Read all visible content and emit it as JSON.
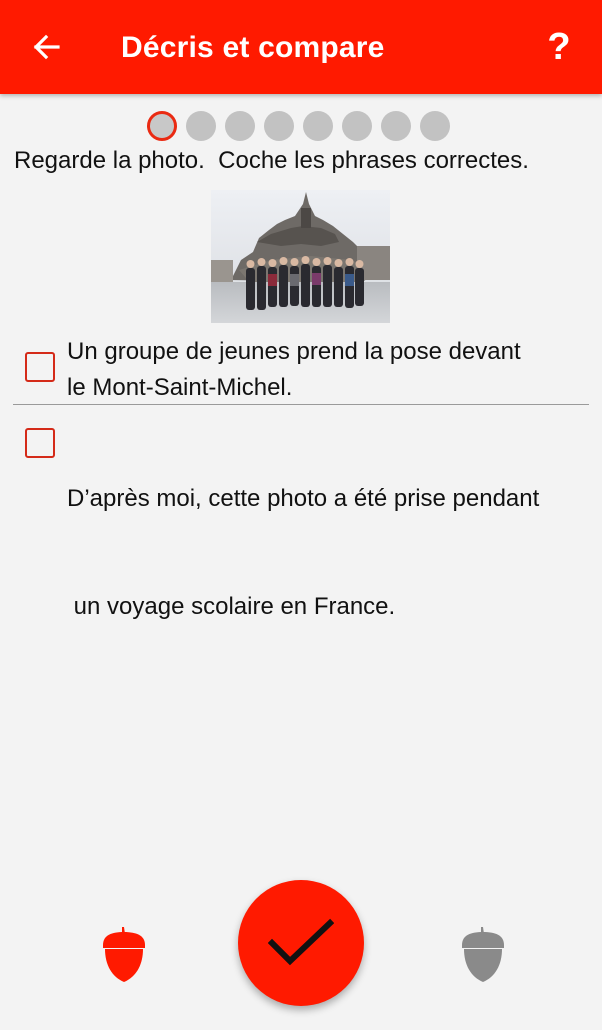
{
  "appbar": {
    "title": "Décris et compare",
    "back_icon": "arrow-left-icon",
    "help_label": "?",
    "color": "#ff1a00"
  },
  "progress": {
    "total": 8,
    "current": 1
  },
  "instruction": "Regarde la photo.  Coche les phrases correctes.",
  "photo": {
    "subject": "group-photo-mont-saint-michel"
  },
  "statements": [
    {
      "line1": "Un groupe de jeunes prend la pose devant",
      "line2": "le Mont-Saint-Michel.",
      "checked": false
    },
    {
      "line1": "D’après moi, cette photo a été prise pendant",
      "line2": " un voyage scolaire en France.",
      "checked": false
    }
  ],
  "footer": {
    "check_icon": "checkmark-icon",
    "left_icon": "acorn-red-icon",
    "right_icon": "acorn-gray-icon",
    "accent": "#ff1a00",
    "inactive": "#8a8a8a"
  }
}
